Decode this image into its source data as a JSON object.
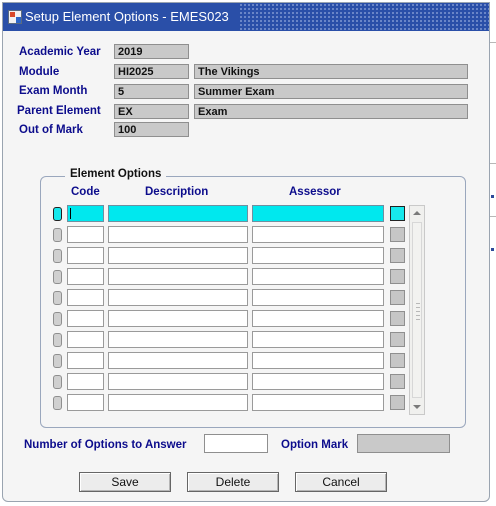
{
  "window": {
    "title": "Setup Element Options - EMES023"
  },
  "header": {
    "academic_year": {
      "label": "Academic Year",
      "value": "2019"
    },
    "module": {
      "label": "Module",
      "code": "HI2025",
      "name": "The Vikings"
    },
    "exam_month": {
      "label": "Exam Month",
      "value": "5",
      "name": "Summer Exam"
    },
    "parent_element": {
      "label": "Parent Element",
      "code": "EX",
      "name": "Exam"
    },
    "out_of_mark": {
      "label": "Out of Mark",
      "value": "100"
    }
  },
  "element_options": {
    "legend": "Element Options",
    "columns": [
      "Code",
      "Description",
      "Assessor"
    ],
    "rows": [
      {
        "code": "",
        "description": "",
        "assessor": ""
      },
      {
        "code": "",
        "description": "",
        "assessor": ""
      },
      {
        "code": "",
        "description": "",
        "assessor": ""
      },
      {
        "code": "",
        "description": "",
        "assessor": ""
      },
      {
        "code": "",
        "description": "",
        "assessor": ""
      },
      {
        "code": "",
        "description": "",
        "assessor": ""
      },
      {
        "code": "",
        "description": "",
        "assessor": ""
      },
      {
        "code": "",
        "description": "",
        "assessor": ""
      },
      {
        "code": "",
        "description": "",
        "assessor": ""
      },
      {
        "code": "",
        "description": "",
        "assessor": ""
      }
    ],
    "active_row": 0
  },
  "footer": {
    "num_options_label": "Number of Options to Answer",
    "num_options_value": "",
    "option_mark_label": "Option Mark",
    "option_mark_value": ""
  },
  "buttons": {
    "save": "Save",
    "delete": "Delete",
    "cancel": "Cancel"
  },
  "colors": {
    "label_blue": "#0c0c8c",
    "title_bar": "#2a4fa8",
    "active_row": "#00e8ee",
    "readonly_field": "#c9c9c9"
  },
  "icons": {
    "app": "form-app-icon",
    "scroll_up": "scroll-up-arrow-icon",
    "scroll_down": "scroll-down-arrow-icon"
  }
}
